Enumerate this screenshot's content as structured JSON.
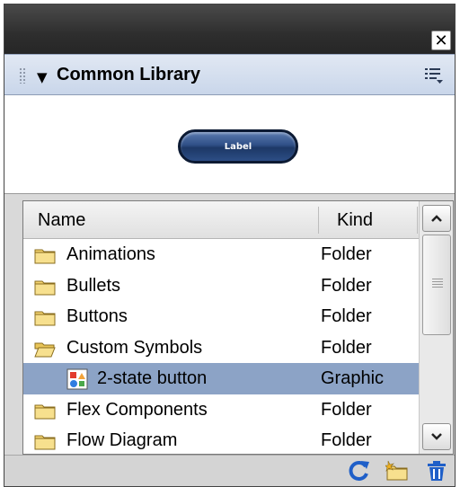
{
  "panel": {
    "title": "Common Library",
    "close_glyph": "✕",
    "collapse_glyph": "▼"
  },
  "preview": {
    "button_label": "Label"
  },
  "list": {
    "columns": {
      "name": "Name",
      "kind": "Kind"
    },
    "rows": [
      {
        "name": "Animations",
        "kind": "Folder",
        "icon": "folder-icon"
      },
      {
        "name": "Bullets",
        "kind": "Folder",
        "icon": "folder-icon"
      },
      {
        "name": "Buttons",
        "kind": "Folder",
        "icon": "folder-icon"
      },
      {
        "name": "Custom Symbols",
        "kind": "Folder",
        "icon": "folder-open-icon"
      },
      {
        "name": "2-state button",
        "kind": "Graphic",
        "icon": "graphic-symbol-icon",
        "selected": true
      },
      {
        "name": "Flex Components",
        "kind": "Folder",
        "icon": "folder-icon"
      },
      {
        "name": "Flow Diagram",
        "kind": "Folder",
        "icon": "folder-icon"
      }
    ]
  },
  "footer": {
    "icons": [
      "refresh-icon",
      "new-folder-icon",
      "delete-icon"
    ]
  },
  "colors": {
    "selection": "#8ca3c6",
    "header": "#c9d6ea",
    "titlebar": "#2e2e2e"
  }
}
